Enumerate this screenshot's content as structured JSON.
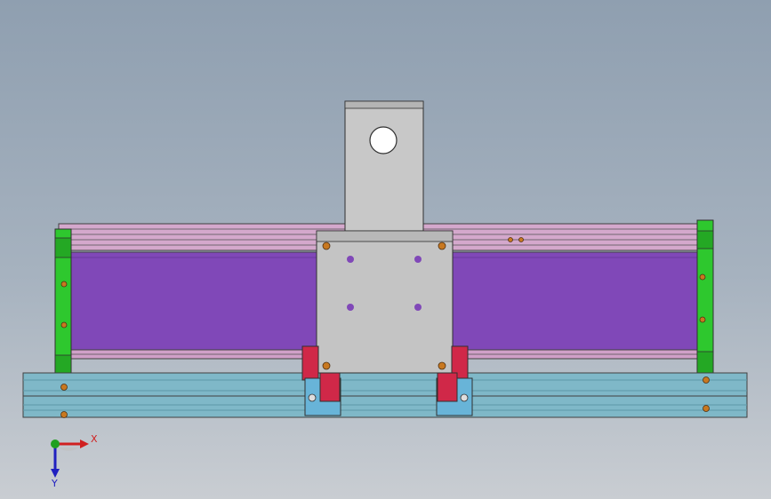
{
  "viewport": {
    "background_top": "#8f9fb0",
    "background_bottom": "#c9cdd2"
  },
  "model": {
    "colors": {
      "rail": "#7fb8c8",
      "rail_dark": "#5e97a8",
      "body_purple": "#8048b8",
      "body_pink": "#c8a0c8",
      "end_cap_green": "#2ec82e",
      "carriage_gray": "#c4c4c4",
      "bracket_gray": "#c8c8c8",
      "clamp_red": "#d02848",
      "slider_blue": "#68b4d8",
      "screw_orange": "#c87820"
    }
  },
  "triad": {
    "x_label": "X",
    "y_label": "Y",
    "x_color": "#d02020",
    "y_color": "#2020c0",
    "origin_color": "#20a020"
  }
}
